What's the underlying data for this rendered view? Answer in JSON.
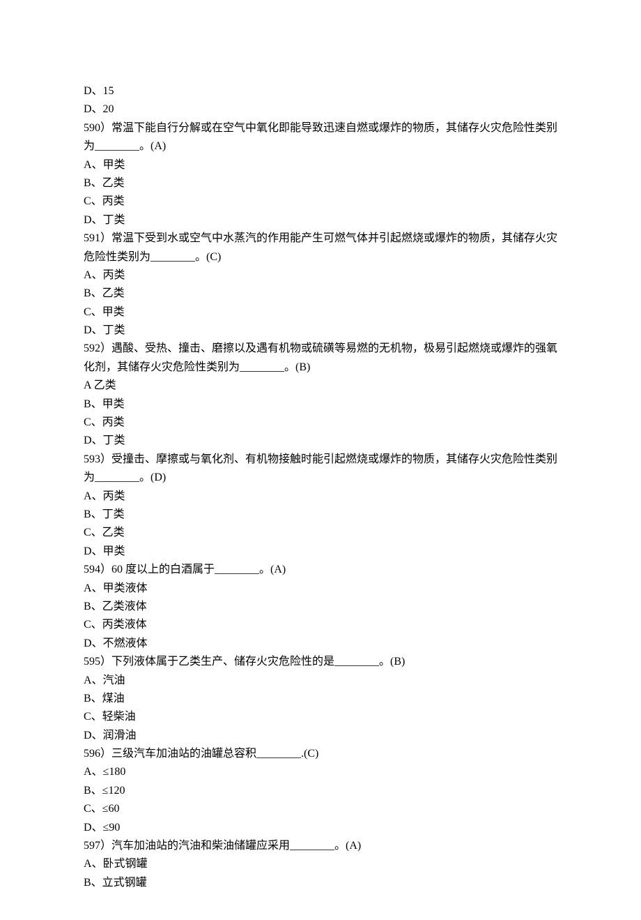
{
  "lines": [
    "D、15",
    "D、20",
    "590）常温下能自行分解或在空气中氧化即能导致迅速自燃或爆炸的物质，其储存火灾危险性类别为________。(A)",
    "A、甲类",
    "B、乙类",
    "C、丙类",
    "D、丁类",
    "591）常温下受到水或空气中水蒸汽的作用能产生可燃气体并引起燃烧或爆炸的物质，其储存火灾危险性类别为________。(C)",
    "A、丙类",
    "B、乙类",
    "C、甲类",
    "D、丁类",
    "592）遇酸、受热、撞击、磨擦以及遇有机物或硫磺等易燃的无机物，极易引起燃烧或爆炸的强氧化剂，其储存火灾危险性类别为________。(B)",
    "A 乙类",
    "B、甲类",
    "C、丙类",
    "D、丁类",
    "593）受撞击、摩擦或与氧化剂、有机物接触时能引起燃烧或爆炸的物质，其储存火灾危险性类别为________。(D)",
    "A、丙类",
    "B、丁类",
    "C、乙类",
    "D、甲类",
    "594）60 度以上的白酒属于________。(A)",
    "A、甲类液体",
    "B、乙类液体",
    "C、丙类液体",
    "D、不燃液体",
    "595）下列液体属于乙类生产、储存火灾危险性的是________。(B)",
    "A、汽油",
    "B、煤油",
    "C、轻柴油",
    "D、润滑油",
    "596）三级汽车加油站的油罐总容积________.(C)",
    "A、≤180",
    "B、≤120",
    "C、≤60",
    "D、≤90",
    "597）汽车加油站的汽油和柴油储罐应采用________。(A)",
    "A、卧式钢罐",
    "B、立式钢罐"
  ]
}
